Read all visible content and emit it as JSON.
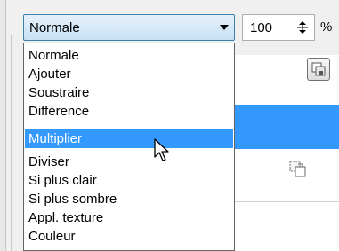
{
  "blend_mode": {
    "selected_label": "Normale",
    "options": [
      "Normale",
      "Ajouter",
      "Soustraire",
      "Différence",
      "Multiplier",
      "Diviser",
      "Si plus clair",
      "Si plus sombre",
      "Appl. texture",
      "Couleur"
    ],
    "highlighted_option": "Multiplier"
  },
  "opacity": {
    "value": "100",
    "unit": "%"
  },
  "colors": {
    "highlight": "#3399ff",
    "combo_border": "#3c7fb1"
  }
}
